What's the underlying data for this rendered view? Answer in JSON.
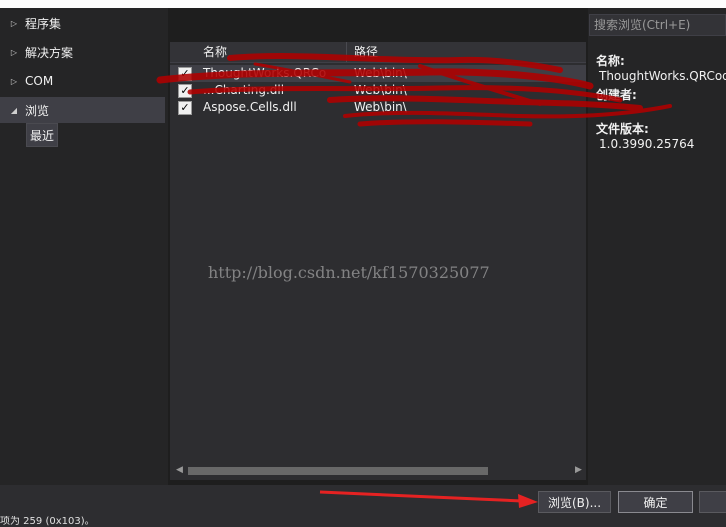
{
  "left_nav": {
    "items": [
      {
        "label": "程序集",
        "expanded": false
      },
      {
        "label": "解决方案",
        "expanded": false
      },
      {
        "label": "COM",
        "expanded": false
      },
      {
        "label": "浏览",
        "expanded": true
      }
    ],
    "sub_items": [
      {
        "label": "最近"
      }
    ]
  },
  "list": {
    "columns": [
      {
        "label": "名称"
      },
      {
        "label": "路径"
      }
    ],
    "rows": [
      {
        "checked": true,
        "name": "ThoughtWorks.QRCo",
        "path": "Web\\bin\\"
      },
      {
        "checked": true,
        "name": "...Charting.dll",
        "path": "Web\\bin\\"
      },
      {
        "checked": true,
        "name": "Aspose.Cells.dll",
        "path": "Web\\bin\\"
      }
    ]
  },
  "search": {
    "placeholder": "搜索浏览(Ctrl+E)"
  },
  "details": {
    "name_label": "名称:",
    "name_value": "ThoughtWorks.QRCod",
    "creator_label": "创建者:",
    "version_label": "文件版本:",
    "version_value": "1.0.3990.25764"
  },
  "buttons": {
    "browse": "浏览(B)...",
    "ok": "确定"
  },
  "status_text": "项为 259 (0x103)。",
  "watermark": "http://blog.csdn.net/kf1570325077",
  "colors": {
    "annotation_red": "#e52222",
    "scribble_red": "#b00000"
  }
}
